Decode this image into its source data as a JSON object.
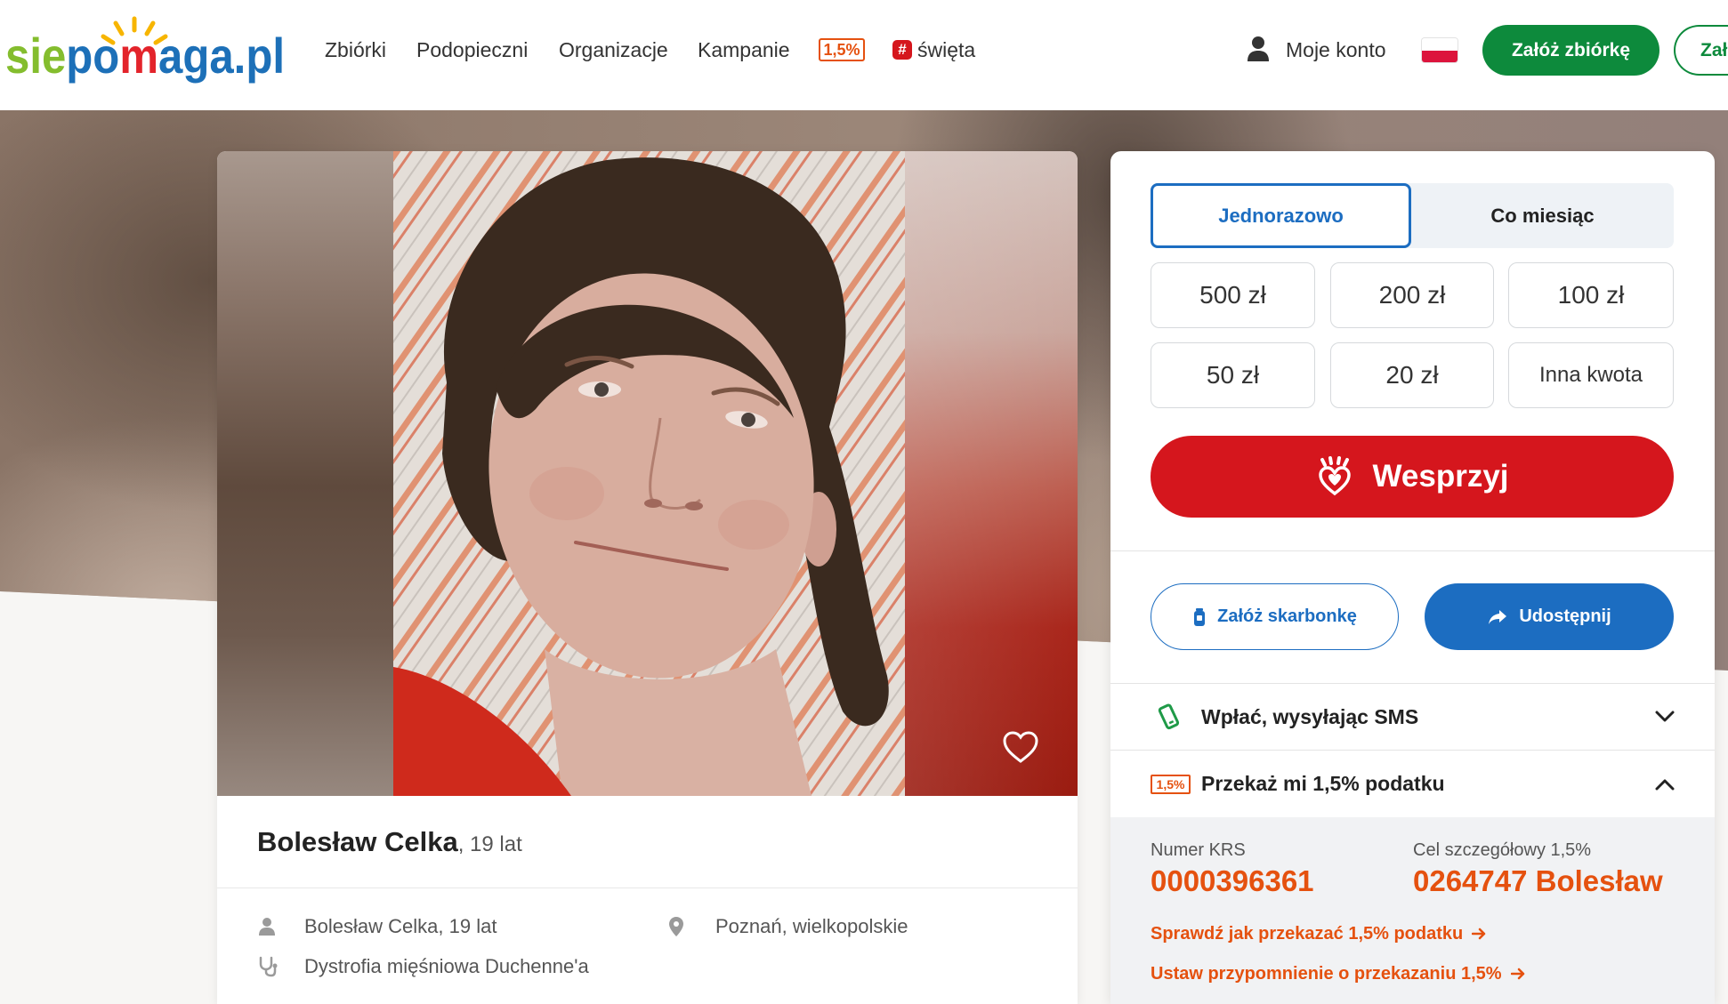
{
  "header": {
    "logo": {
      "part1": "sie",
      "part2": "po",
      "part3": "m",
      "part4": "aga.pl"
    },
    "nav": [
      {
        "label": "Zbiórki"
      },
      {
        "label": "Podopieczni"
      },
      {
        "label": "Organizacje"
      },
      {
        "label": "Kampanie"
      }
    ],
    "tax_badge": "1,5%",
    "holidays": {
      "icon_glyph": "#",
      "label": "święta"
    },
    "account": {
      "icon": "user-icon",
      "label": "Moje konto"
    },
    "language": {
      "icon": "flag-pl-icon"
    },
    "create_fundraiser_label": "Załóż zbiórkę",
    "partial_button_label": "Zał"
  },
  "campaign": {
    "favorite_icon": "heart-outline-icon",
    "name": "Bolesław Celka",
    "age": ", 19 lat",
    "details": [
      {
        "icon": "person-icon",
        "text": "Bolesław Celka, 19 lat"
      },
      {
        "icon": "location-pin-icon",
        "text": "Poznań, wielkopolskie"
      },
      {
        "icon": "stethoscope-icon",
        "text": "Dystrofia mięśniowa Duchenne'a"
      }
    ]
  },
  "donation": {
    "frequency": [
      {
        "label": "Jednorazowo",
        "selected": true
      },
      {
        "label": "Co miesiąc",
        "selected": false
      }
    ],
    "amounts": [
      "500 zł",
      "200 zł",
      "100 zł",
      "50 zł",
      "20 zł",
      "Inna kwota"
    ],
    "support_button": {
      "icon": "hand-heart-icon",
      "label": "Wesprzyj"
    },
    "piggybank_button": {
      "icon": "jar-icon",
      "label": "Załóż skarbonkę"
    },
    "share_button": {
      "icon": "share-arrow-icon",
      "label": "Udostępnij"
    },
    "sms": {
      "icon": "phone-icon",
      "label": "Wpłać, wysyłając SMS",
      "expanded": false
    },
    "tax": {
      "badge": "1,5%",
      "label": "Przekaż mi 1,5% podatku",
      "expanded": true,
      "krs_label": "Numer KRS",
      "krs_value": "0000396361",
      "goal_label": "Cel szczegółowy 1,5%",
      "goal_value": "0264747 Bolesław",
      "links": [
        {
          "label": "Sprawdź jak przekazać 1,5% podatku"
        },
        {
          "label": "Ustaw przypomnienie o przekazaniu 1,5%"
        }
      ]
    }
  },
  "colors": {
    "brand_green": "#0d8a3c",
    "brand_blue": "#1c6dc1",
    "support_red": "#d5161d",
    "tax_orange": "#e5510f",
    "logo_green": "#84bd2e",
    "logo_sun": "#f7b500"
  }
}
